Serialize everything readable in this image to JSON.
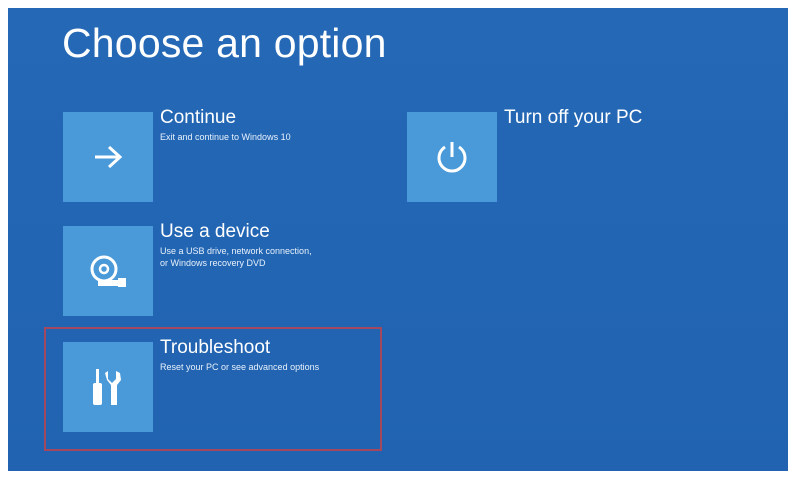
{
  "title": "Choose an option",
  "options": [
    {
      "label": "Continue",
      "description": "Exit and continue to Windows 10",
      "icon": "arrow-right-icon"
    },
    {
      "label": "Use a device",
      "description": "Use a USB drive, network connection,\nor Windows recovery DVD",
      "icon": "disc-drive-icon"
    },
    {
      "label": "Troubleshoot",
      "description": "Reset your PC or see advanced options",
      "icon": "tools-icon"
    },
    {
      "label": "Turn off your PC",
      "description": "",
      "icon": "power-icon"
    }
  ],
  "colors": {
    "background": "#2366b4",
    "tile": "#4a9ad9",
    "highlight_border": "#a44860"
  }
}
